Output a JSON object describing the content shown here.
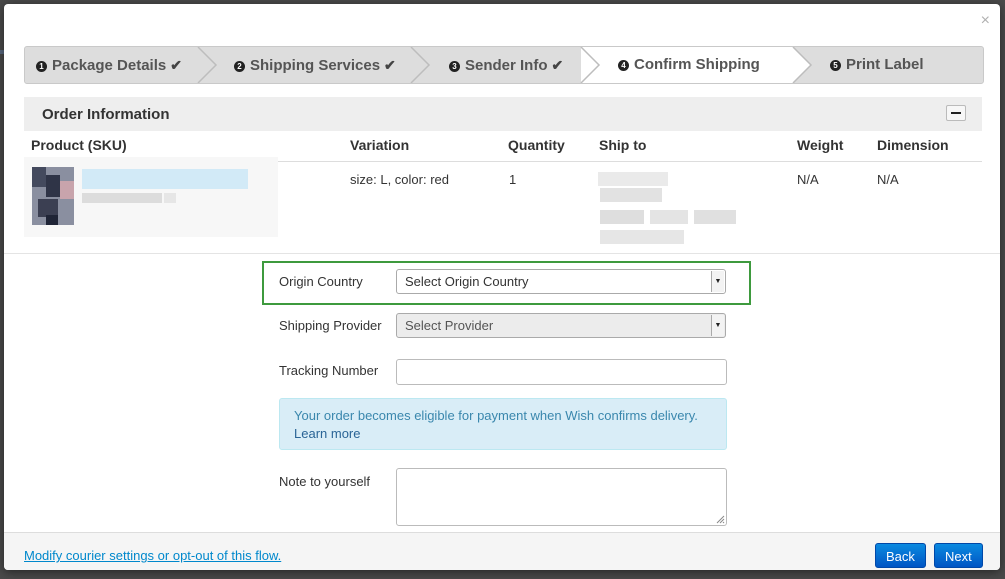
{
  "dialog": {
    "close_label": "×"
  },
  "steps": [
    {
      "number": "1",
      "label": "Package Details",
      "check": "✔"
    },
    {
      "number": "2",
      "label": "Shipping Services",
      "check": "✔"
    },
    {
      "number": "3",
      "label": "Sender Info",
      "check": "✔"
    },
    {
      "number": "4",
      "label": "Confirm Shipping"
    },
    {
      "number": "5",
      "label": "Print Label"
    }
  ],
  "active_step": 4,
  "order_info": {
    "title": "Order Information",
    "columns": [
      "Product (SKU)",
      "Variation",
      "Quantity",
      "Ship to",
      "Weight",
      "Dimension"
    ],
    "row": {
      "variation": "size: L, color: red",
      "quantity": "1",
      "weight": "N/A",
      "dimension": "N/A"
    }
  },
  "form": {
    "origin_country": {
      "label": "Origin Country",
      "placeholder": "Select Origin Country"
    },
    "shipping_provider": {
      "label": "Shipping Provider",
      "placeholder": "Select Provider"
    },
    "tracking_number": {
      "label": "Tracking Number",
      "value": ""
    },
    "alert": {
      "text": "Your order becomes eligible for payment when Wish confirms delivery.",
      "link": "Learn more"
    },
    "note": {
      "label": "Note to yourself",
      "value": ""
    }
  },
  "footer": {
    "link": "Modify courier settings or opt-out of this flow.",
    "back_label": "Back",
    "next_label": "Next"
  },
  "colors": {
    "highlight": "#3e9a3e",
    "primary_button": "#0066cc",
    "alert_bg": "#d9edf7",
    "alert_text": "#3a87ad",
    "link": "#0088cc"
  }
}
